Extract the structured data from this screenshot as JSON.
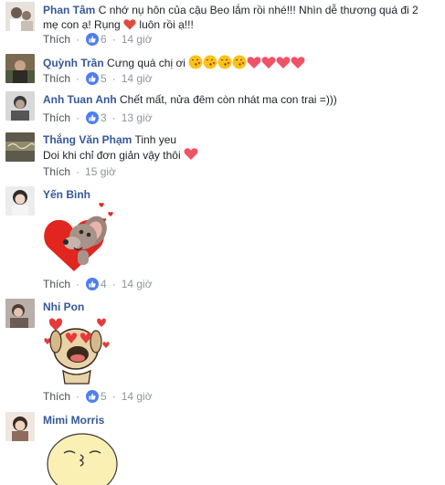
{
  "comments": [
    {
      "author": "Phan Tâm",
      "text_line1": "C nhớ nụ hôn của cậu Beo lắm rồi nhé!!! Nhìn dễ thương quá đi 2",
      "text_line2a": "mẹ con ạ! Rụng",
      "text_line2b": "luôn rồi ạ!!!",
      "like_label": "Thích",
      "reaction_count": "6",
      "time": "14 giờ"
    },
    {
      "author": "Quỳnh Trần",
      "text": "Cưng quá chị ơi",
      "like_label": "Thích",
      "reaction_count": "5",
      "time": "14 giờ"
    },
    {
      "author": "Anh Tuan Anh",
      "text": "Chết mất, nửa đêm còn nhát ma con trai =)))",
      "like_label": "Thích",
      "reaction_count": "3",
      "time": "13 giờ"
    },
    {
      "author": "Thắng Văn Phạm",
      "text_line1": "Tinh yeu",
      "text_line2": "Doi khi chỉ đơn giản vậy thôi",
      "like_label": "Thích",
      "time": "15 giờ"
    },
    {
      "author": "Yến Bình",
      "like_label": "Thích",
      "reaction_count": "4",
      "time": "14 giờ"
    },
    {
      "author": "Nhi Pon",
      "like_label": "Thích",
      "reaction_count": "5",
      "time": "14 giờ"
    },
    {
      "author": "Mimi Morris"
    }
  ],
  "separator": "·",
  "icons": {
    "reaction": "thumbs-up-icon",
    "heart": "heart-icon",
    "kiss": "kissing-face-icon"
  },
  "colors": {
    "author": "#365899",
    "meta": "#90949c",
    "like_badge": "#4f7ef2",
    "heart": "#f25268"
  }
}
